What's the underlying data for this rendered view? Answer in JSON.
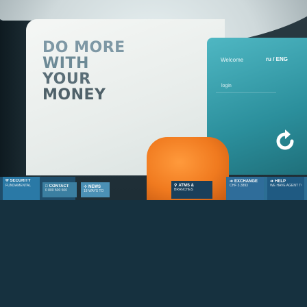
{
  "hero": {
    "line1": "DO MORE",
    "line2": "WITH",
    "line3": "YOUR",
    "line4": "MONEY"
  },
  "header": {
    "welcome": "Welcome",
    "language": "ru / ENG"
  },
  "auth": {
    "login_label": "login"
  },
  "tiles": {
    "security": {
      "label": "SECURITY",
      "sub": "FUNDAMENTAL"
    },
    "contact": {
      "label": "CONTACT",
      "sub": "0 800 500 500"
    },
    "news": {
      "label": "NEWS",
      "sub": "18 WAYS TO"
    },
    "atms": {
      "label": "ATMS &",
      "sub": "BRANCHES"
    },
    "exchange": {
      "label": "EXCHANGE",
      "sub": "CHF 3.3893"
    },
    "help": {
      "label": "HELP",
      "sub": "WE HAVE AGENT TO HELP YOU"
    }
  },
  "icons": {
    "security": "shield-icon",
    "contact": "speech-bubble-icon",
    "news": "rss-icon",
    "atms": "location-pin-icon",
    "exchange": "arrow-icon",
    "help": "arrow-icon",
    "big": "refresh-arrow-icon"
  },
  "colors": {
    "teal": "#2b8f9c",
    "orange": "#f07a1f",
    "navy": "#16313f",
    "blue": "#2a79a6"
  }
}
